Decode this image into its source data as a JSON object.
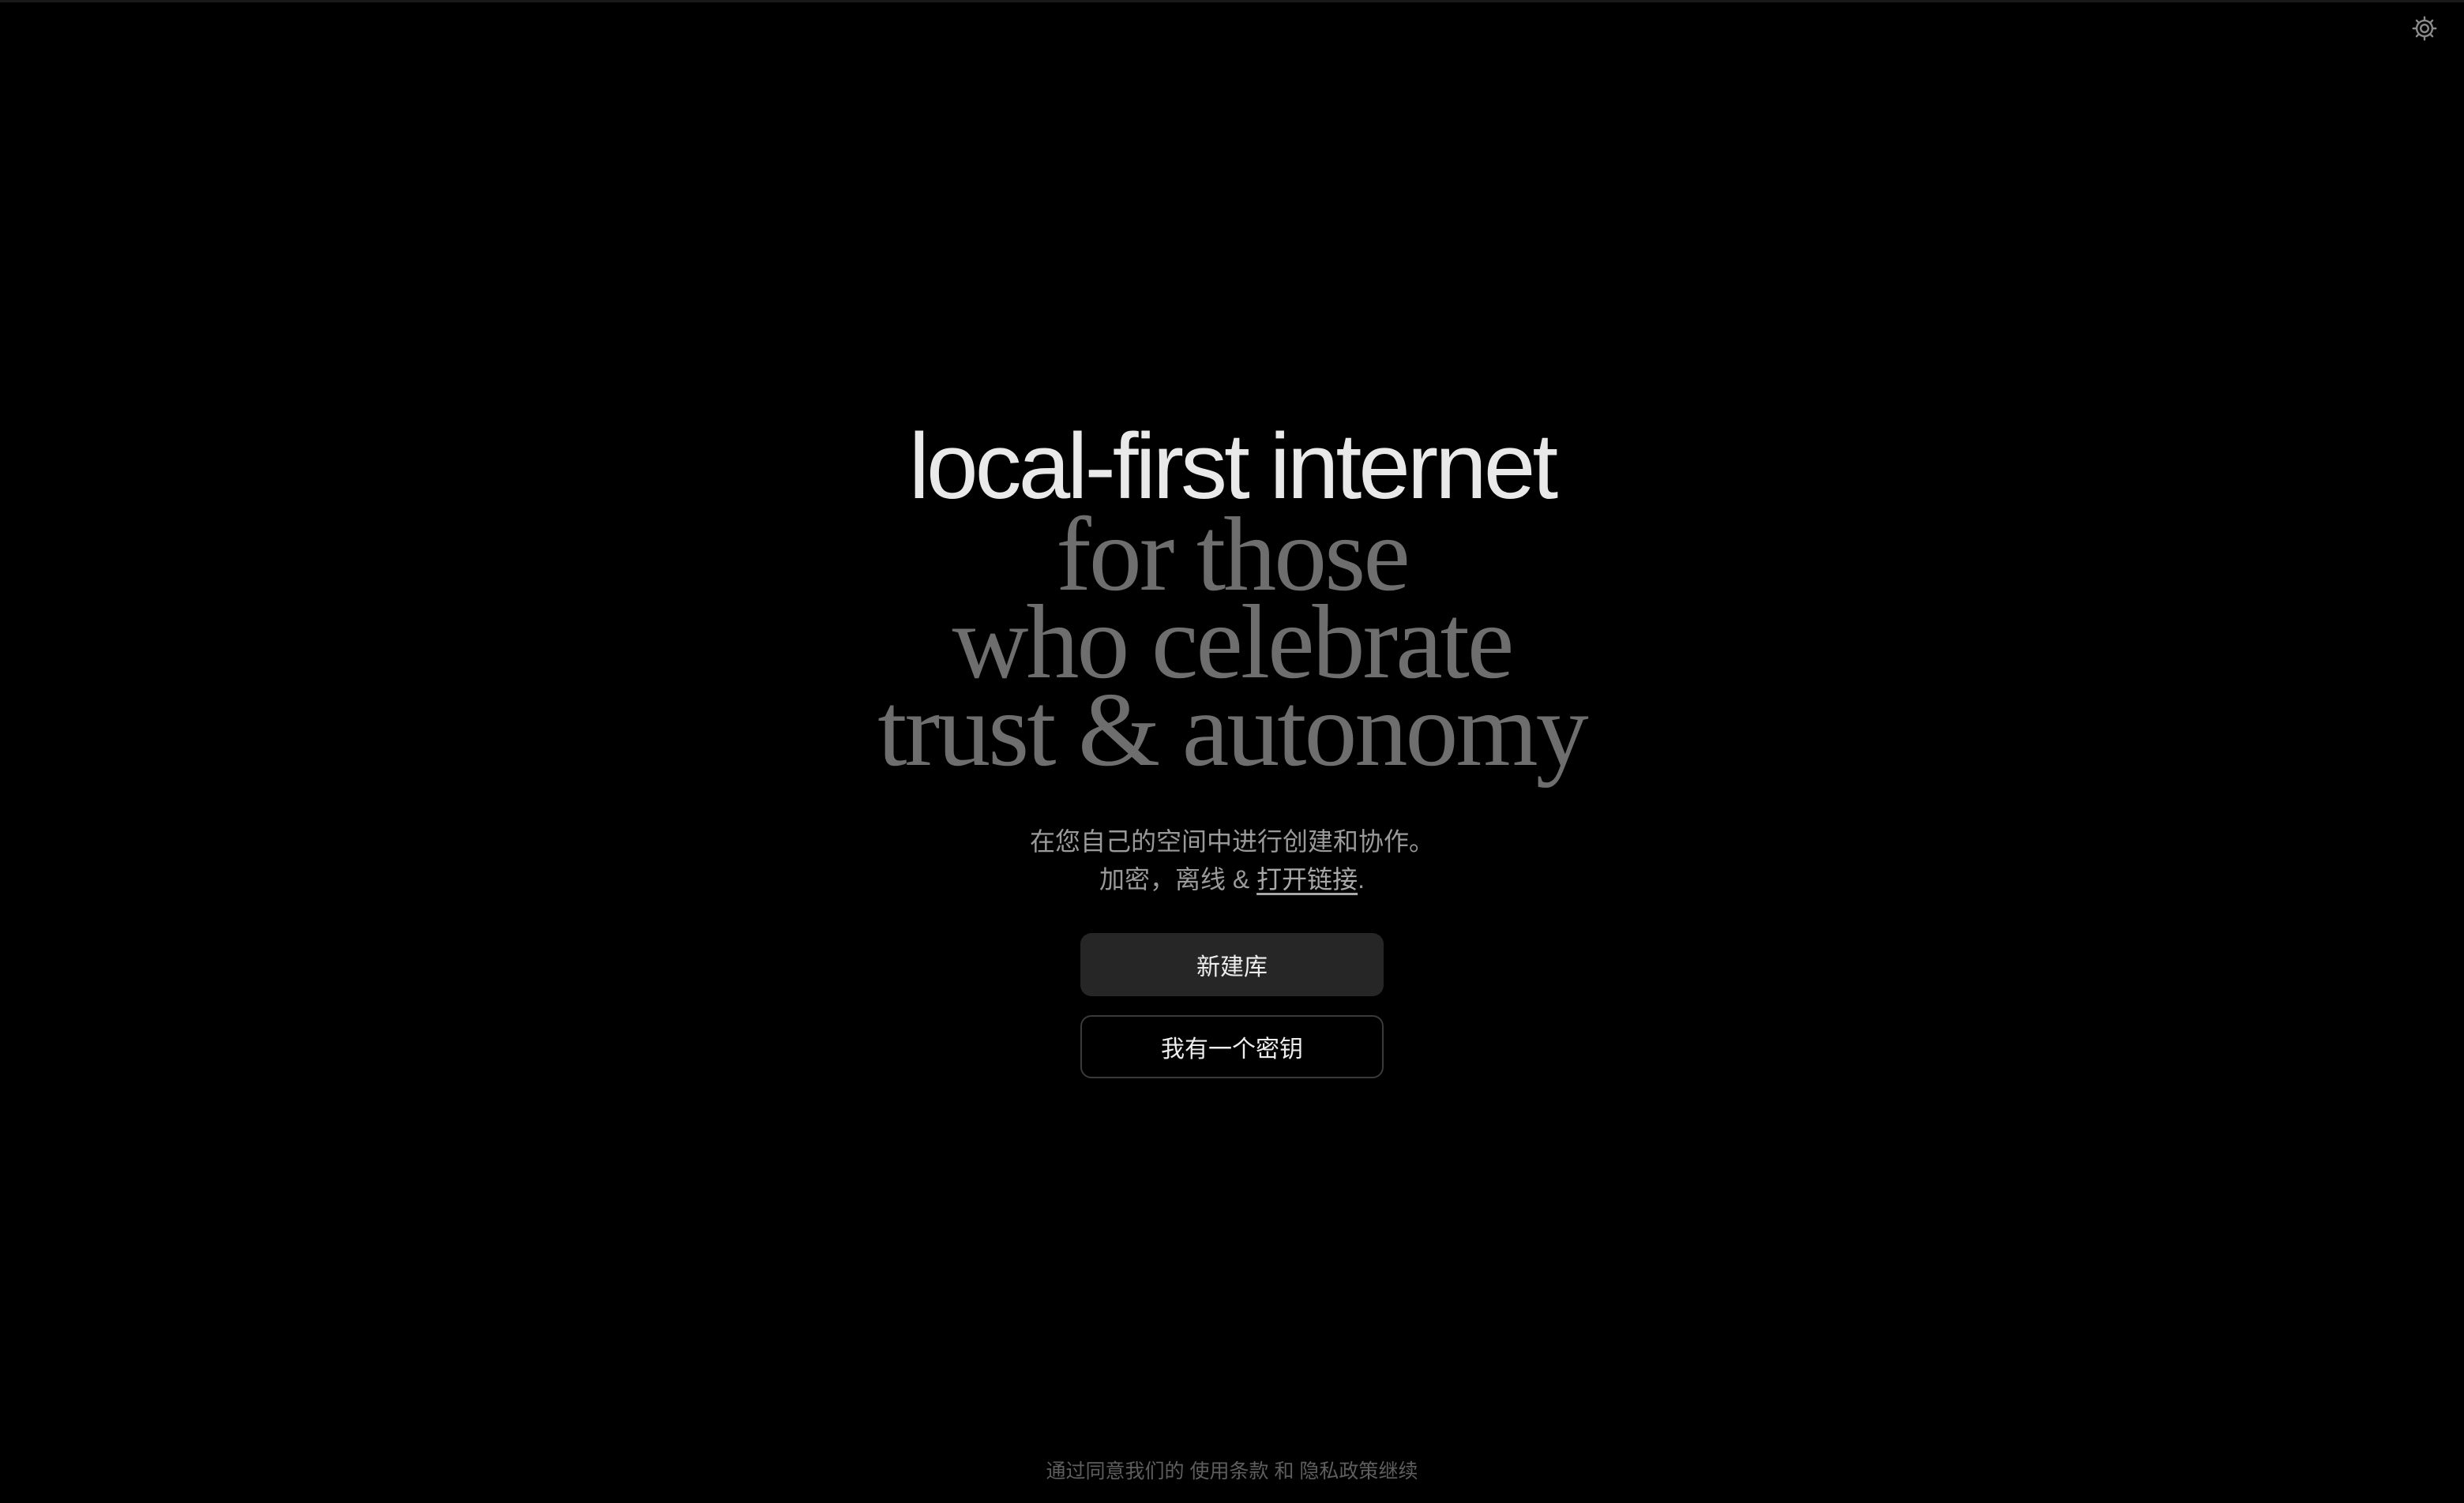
{
  "settings": {
    "icon": "gear-icon"
  },
  "hero": {
    "line1": "local-first internet",
    "line2": "for those",
    "line3": "who celebrate",
    "line4": "trust & autonomy"
  },
  "subtitle": {
    "line1": "在您自己的空间中进行创建和协作。",
    "line2_prefix": "加密，离线 & ",
    "line2_link": "打开链接",
    "line2_suffix": "."
  },
  "buttons": {
    "new_vault": "新建库",
    "have_key": "我有一个密钥"
  },
  "footer": {
    "prefix": "通过同意我们的 ",
    "terms": "使用条款",
    "and": " 和 ",
    "privacy": "隐私政策",
    "suffix": "继续"
  },
  "colors": {
    "background": "#000000",
    "headline": "#e9e9e9",
    "serif_text": "#6e6e6e",
    "primary_button": "#262626"
  }
}
